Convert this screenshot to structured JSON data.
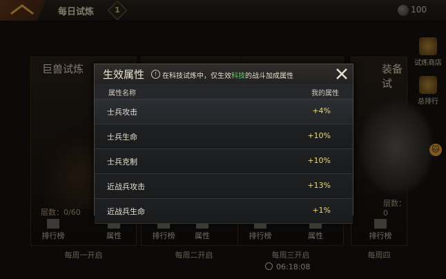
{
  "header": {
    "title": "每日试炼",
    "badge": "1",
    "currency_amount": "100"
  },
  "cards": [
    {
      "name": "巨兽试炼",
      "floor_label": "层数：0/60",
      "buttons": [
        "排行榜",
        "属性"
      ],
      "open_day": "每周一开启"
    },
    {
      "name": "",
      "floor_label": "",
      "buttons": [
        "排行榜",
        "属性"
      ],
      "open_day": "每周二开启"
    },
    {
      "name": "",
      "floor_label": "",
      "buttons": [
        "排行榜",
        "属性"
      ],
      "open_day": "每周三开启"
    },
    {
      "name": "装备试",
      "floor_label": "层数：0",
      "buttons": [
        "排行榜"
      ],
      "open_day": "每周四"
    }
  ],
  "sidebar": {
    "items": [
      {
        "label": "试炼商店"
      },
      {
        "label": "总排行"
      }
    ]
  },
  "timer": "06:18:08",
  "modal": {
    "title": "生效属性",
    "hint_prefix": "在科技试炼中，仅生效",
    "hint_highlight": "科技",
    "hint_suffix": "的战斗加成属性",
    "columns": {
      "name": "属性名称",
      "value": "我的属性"
    },
    "rows": [
      {
        "name": "士兵攻击",
        "value": "+4%"
      },
      {
        "name": "士兵生命",
        "value": "+10%"
      },
      {
        "name": "士兵克制",
        "value": "+10%"
      },
      {
        "name": "近战兵攻击",
        "value": "+13%"
      },
      {
        "name": "近战兵生命",
        "value": "+1%"
      }
    ]
  },
  "colors": {
    "accent_green": "#66d26a",
    "value_gold": "#f0d77a"
  }
}
